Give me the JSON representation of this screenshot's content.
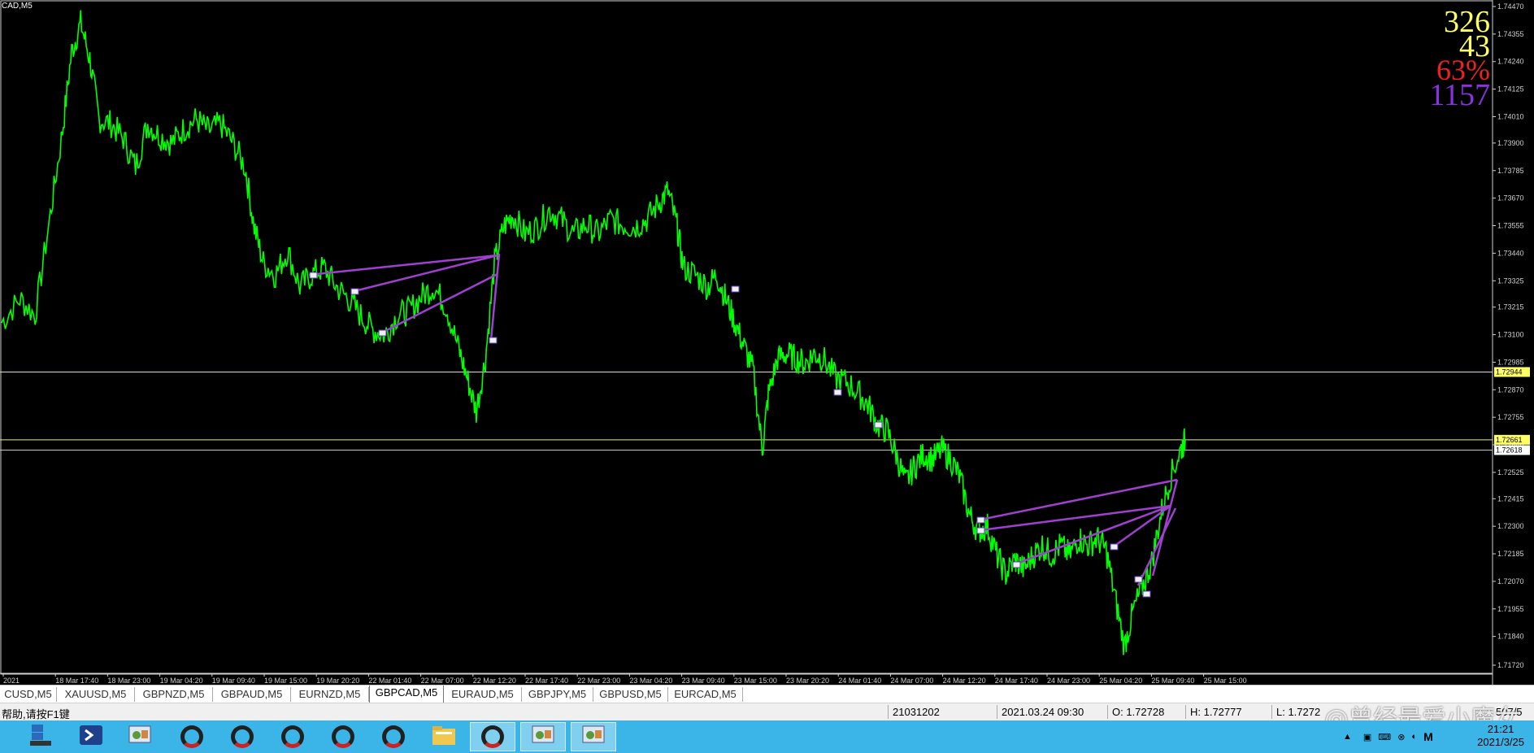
{
  "window": {
    "title": "CAD,M5"
  },
  "stats": [
    {
      "value": "326",
      "color": "#ffff66",
      "size": 38,
      "top": 8
    },
    {
      "value": "43",
      "color": "#ffff66",
      "size": 38,
      "top": 38
    },
    {
      "value": "63%",
      "color": "#ee2222",
      "size": 36,
      "top": 68
    },
    {
      "value": "1157",
      "color": "#8833dd",
      "size": 38,
      "top": 98
    }
  ],
  "chart_data": {
    "type": "line",
    "series": [
      {
        "color": "#00ff00"
      }
    ],
    "ylim": [
      1.7172,
      1.7447
    ],
    "price_ticks": [
      "1.74470",
      "1.74355",
      "1.74240",
      "1.74125",
      "1.74010",
      "1.73900",
      "1.73785",
      "1.73670",
      "1.73555",
      "1.73440",
      "1.73325",
      "1.73215",
      "1.73100",
      "1.72985",
      "1.72870",
      "1.72755",
      "1.72640",
      "1.72525",
      "1.72415",
      "1.72300",
      "1.72185",
      "1.72070",
      "1.71955",
      "1.71840",
      "1.71720"
    ],
    "time_ticks": [
      "2021",
      "18 Mar 17:40",
      "18 Mar 23:00",
      "19 Mar 04:20",
      "19 Mar 09:40",
      "19 Mar 15:00",
      "19 Mar 20:20",
      "22 Mar 01:40",
      "22 Mar 07:00",
      "22 Mar 12:20",
      "22 Mar 17:40",
      "22 Mar 23:00",
      "23 Mar 04:20",
      "23 Mar 09:40",
      "23 Mar 15:00",
      "23 Mar 20:20",
      "24 Mar 01:40",
      "24 Mar 07:00",
      "24 Mar 12:20",
      "24 Mar 17:40",
      "24 Mar 23:00",
      "25 Mar 04:20",
      "25 Mar 09:40",
      "25 Mar 15:00"
    ],
    "hlines": [
      {
        "price": 1.72944,
        "label": "1.72944",
        "color": "#e8e870"
      },
      {
        "price": 1.72661,
        "label": "1.72661",
        "color": "#e8e8a0"
      },
      {
        "price": 1.72618,
        "label": "1.72618",
        "color": "#c8c8c8"
      }
    ],
    "price_path": [
      [
        0.0,
        1.7315
      ],
      [
        0.012,
        1.7325
      ],
      [
        0.022,
        1.7318
      ],
      [
        0.032,
        1.736
      ],
      [
        0.04,
        1.7395
      ],
      [
        0.046,
        1.7428
      ],
      [
        0.052,
        1.744
      ],
      [
        0.058,
        1.7425
      ],
      [
        0.064,
        1.74
      ],
      [
        0.072,
        1.7398
      ],
      [
        0.08,
        1.7392
      ],
      [
        0.088,
        1.738
      ],
      [
        0.096,
        1.7398
      ],
      [
        0.104,
        1.7393
      ],
      [
        0.112,
        1.739
      ],
      [
        0.12,
        1.7396
      ],
      [
        0.128,
        1.74
      ],
      [
        0.136,
        1.7395
      ],
      [
        0.144,
        1.7398
      ],
      [
        0.152,
        1.739
      ],
      [
        0.16,
        1.738
      ],
      [
        0.166,
        1.7355
      ],
      [
        0.172,
        1.734
      ],
      [
        0.18,
        1.7335
      ],
      [
        0.188,
        1.7345
      ],
      [
        0.196,
        1.733
      ],
      [
        0.204,
        1.7335
      ],
      [
        0.212,
        1.7338
      ],
      [
        0.22,
        1.733
      ],
      [
        0.228,
        1.7325
      ],
      [
        0.236,
        1.7318
      ],
      [
        0.244,
        1.7312
      ],
      [
        0.252,
        1.731
      ],
      [
        0.26,
        1.7318
      ],
      [
        0.268,
        1.732
      ],
      [
        0.276,
        1.7326
      ],
      [
        0.284,
        1.733
      ],
      [
        0.292,
        1.7322
      ],
      [
        0.3,
        1.7305
      ],
      [
        0.306,
        1.7292
      ],
      [
        0.312,
        1.7278
      ],
      [
        0.318,
        1.73
      ],
      [
        0.324,
        1.734
      ],
      [
        0.33,
        1.7355
      ],
      [
        0.336,
        1.736
      ],
      [
        0.344,
        1.7352
      ],
      [
        0.352,
        1.7355
      ],
      [
        0.36,
        1.7362
      ],
      [
        0.368,
        1.7358
      ],
      [
        0.376,
        1.7352
      ],
      [
        0.384,
        1.7356
      ],
      [
        0.392,
        1.7352
      ],
      [
        0.4,
        1.7358
      ],
      [
        0.408,
        1.7356
      ],
      [
        0.416,
        1.7355
      ],
      [
        0.424,
        1.7358
      ],
      [
        0.432,
        1.7365
      ],
      [
        0.438,
        1.737
      ],
      [
        0.444,
        1.7355
      ],
      [
        0.448,
        1.7338
      ],
      [
        0.456,
        1.7335
      ],
      [
        0.464,
        1.733
      ],
      [
        0.47,
        1.7335
      ],
      [
        0.476,
        1.7325
      ],
      [
        0.482,
        1.7315
      ],
      [
        0.488,
        1.7305
      ],
      [
        0.494,
        1.7295
      ],
      [
        0.5,
        1.7262
      ],
      [
        0.504,
        1.7285
      ],
      [
        0.51,
        1.73
      ],
      [
        0.516,
        1.7302
      ],
      [
        0.522,
        1.73
      ],
      [
        0.528,
        1.7298
      ],
      [
        0.534,
        1.7302
      ],
      [
        0.54,
        1.73
      ],
      [
        0.548,
        1.7292
      ],
      [
        0.556,
        1.729
      ],
      [
        0.564,
        1.7285
      ],
      [
        0.57,
        1.728
      ],
      [
        0.576,
        1.7272
      ],
      [
        0.582,
        1.727
      ],
      [
        0.588,
        1.726
      ],
      [
        0.594,
        1.7248
      ],
      [
        0.6,
        1.7255
      ],
      [
        0.606,
        1.726
      ],
      [
        0.612,
        1.7258
      ],
      [
        0.618,
        1.7262
      ],
      [
        0.624,
        1.7258
      ],
      [
        0.63,
        1.725
      ],
      [
        0.636,
        1.7235
      ],
      [
        0.642,
        1.7228
      ],
      [
        0.648,
        1.723
      ],
      [
        0.654,
        1.7218
      ],
      [
        0.66,
        1.721
      ],
      [
        0.666,
        1.7216
      ],
      [
        0.672,
        1.7212
      ],
      [
        0.678,
        1.7218
      ],
      [
        0.684,
        1.7222
      ],
      [
        0.69,
        1.7218
      ],
      [
        0.696,
        1.7222
      ],
      [
        0.702,
        1.7218
      ],
      [
        0.708,
        1.7225
      ],
      [
        0.714,
        1.7222
      ],
      [
        0.72,
        1.7225
      ],
      [
        0.726,
        1.722
      ],
      [
        0.732,
        1.72
      ],
      [
        0.738,
        1.718
      ],
      [
        0.744,
        1.7195
      ],
      [
        0.75,
        1.7205
      ],
      [
        0.756,
        1.7215
      ],
      [
        0.762,
        1.7235
      ],
      [
        0.768,
        1.725
      ],
      [
        0.775,
        1.7262
      ],
      [
        0.778,
        1.7266
      ]
    ],
    "x_span": 0.778
  },
  "tabs": [
    {
      "label": "CUSD,M5",
      "w": 70
    },
    {
      "label": "XAUUSD,M5",
      "w": 96
    },
    {
      "label": "GBPNZD,M5",
      "w": 96
    },
    {
      "label": "GBPAUD,M5",
      "w": 96
    },
    {
      "label": "EURNZD,M5",
      "w": 96
    },
    {
      "label": "GBPCAD,M5",
      "w": 92,
      "active": true
    },
    {
      "label": "EURAUD,M5",
      "w": 96
    },
    {
      "label": "GBPJPY,M5",
      "w": 88
    },
    {
      "label": "GBPUSD,M5",
      "w": 92
    },
    {
      "label": "EURCAD,M5",
      "w": 92
    }
  ],
  "status": {
    "help": "帮助,请按F1键",
    "profile": "21031202",
    "datetime": "2021.03.24 09:30",
    "open": "O: 1.72728",
    "high": "H: 1.72777",
    "low": "L: 1.7272",
    "extra": "507/5",
    "watermark": "@曾经最爱小魔女"
  },
  "taskbar": {
    "clock_time": "21:21",
    "clock_date": "2021/3/25",
    "accent": "#3bb5e8"
  }
}
